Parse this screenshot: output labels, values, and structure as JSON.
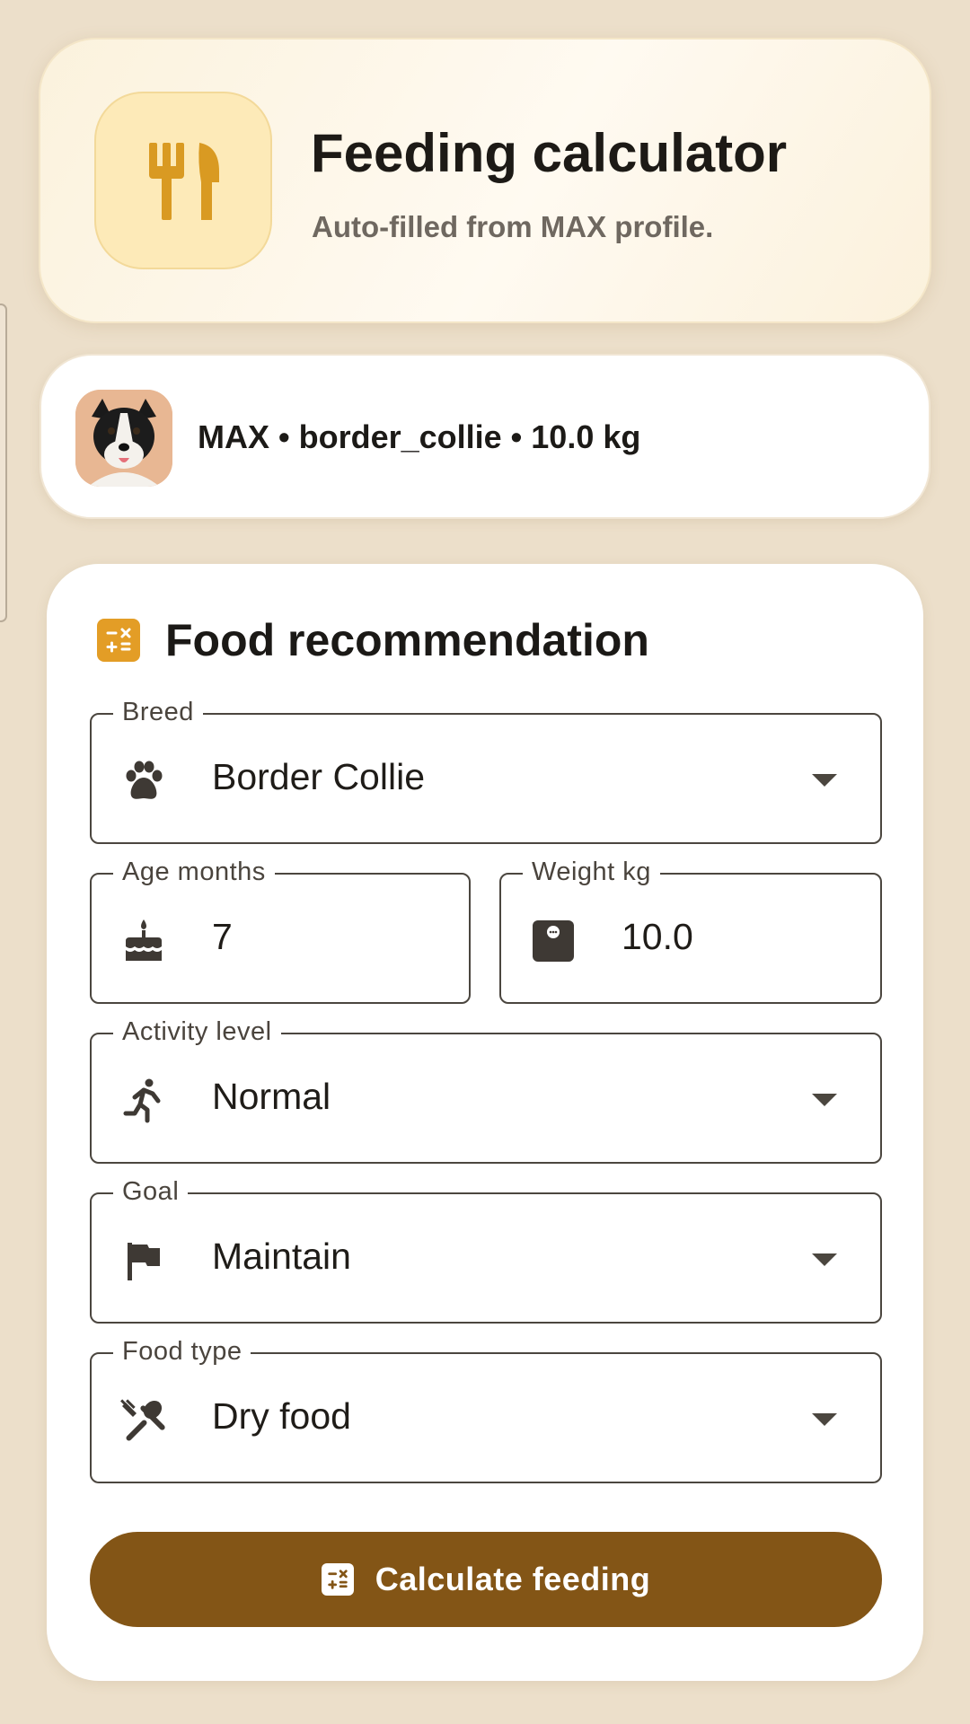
{
  "header": {
    "title": "Feeding calculator",
    "subtitle": "Auto-filled from MAX profile.",
    "icon": "restaurant-icon"
  },
  "pet": {
    "summary": "MAX • border_collie • 10.0 kg",
    "avatar": "border-collie-avatar"
  },
  "form": {
    "section_title": "Food recommendation",
    "section_icon": "calculate-icon",
    "breed": {
      "label": "Breed",
      "value": "Border Collie",
      "icon": "paw-icon"
    },
    "age": {
      "label": "Age months",
      "value": "7",
      "icon": "cake-icon"
    },
    "weight": {
      "label": "Weight kg",
      "value": "10.0",
      "icon": "scale-icon"
    },
    "activity": {
      "label": "Activity level",
      "value": "Normal",
      "icon": "running-icon"
    },
    "goal": {
      "label": "Goal",
      "value": "Maintain",
      "icon": "flag-icon"
    },
    "food_type": {
      "label": "Food type",
      "value": "Dry food",
      "icon": "utensils-crossed-icon"
    },
    "submit_label": "Calculate feeding"
  },
  "colors": {
    "background": "#ecdfca",
    "accent": "#e39d26",
    "button": "#835516"
  }
}
